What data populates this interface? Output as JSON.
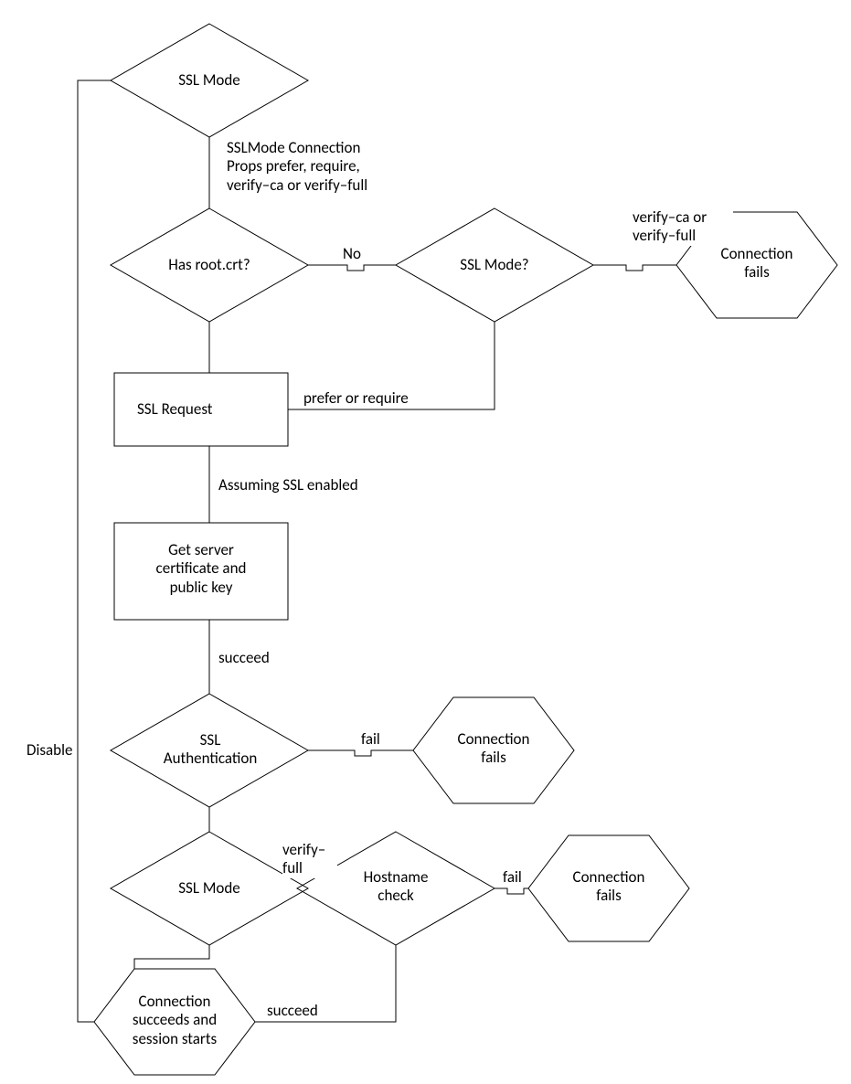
{
  "nodes": {
    "ssl_mode_top": "SSL Mode",
    "has_root_crt": "Has root.crt?",
    "ssl_mode_q": "SSL Mode?",
    "conn_fail_1": "Connection\nfails",
    "ssl_request": "SSL Request",
    "get_server_cert": "Get server\ncertificate and\npublic key",
    "ssl_auth": "SSL\nAuthentication",
    "conn_fail_2": "Connection\nfails",
    "ssl_mode_bottom": "SSL Mode",
    "hostname_check": "Hostname\ncheck",
    "conn_fail_3": "Connection\nfails",
    "conn_success": "Connection\nsucceeds and\nsession starts"
  },
  "edges": {
    "sslmode_conn_props": "SSLMode Connection\nProps prefer, require,\nverify–ca or verify–full",
    "no": "No",
    "verify_ca_full": "verify–ca or\nverify–full",
    "prefer_require": "prefer or require",
    "assuming_ssl": "Assuming SSL enabled",
    "succeed_1": "succeed",
    "fail_1": "fail",
    "verify_full": "verify–\nfull",
    "fail_2": "fail",
    "succeed_2": "succeed",
    "disable": "Disable"
  }
}
